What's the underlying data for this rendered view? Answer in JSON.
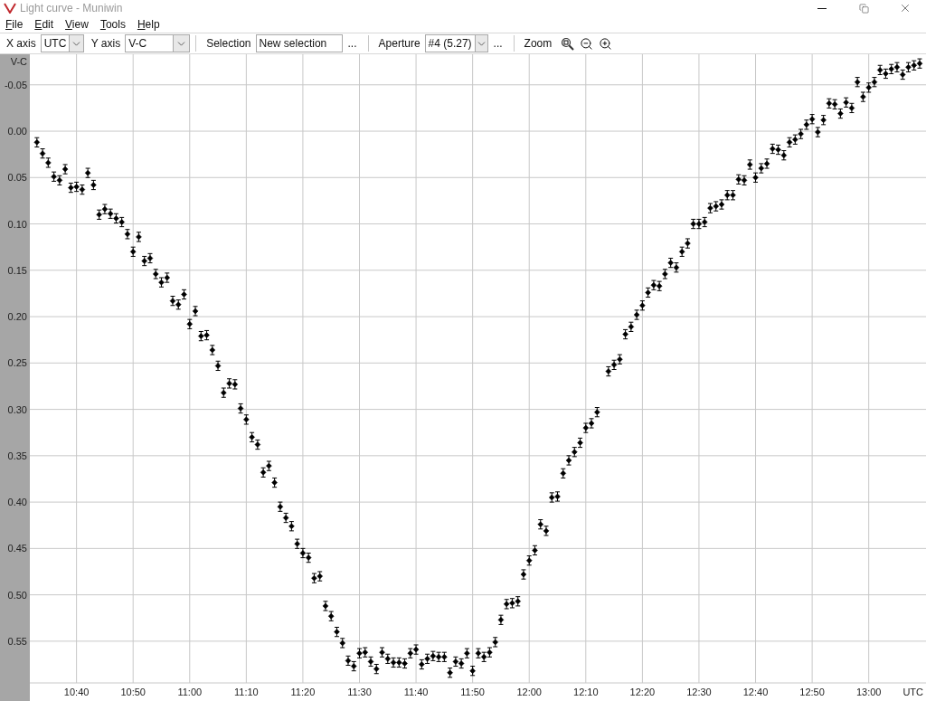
{
  "window": {
    "title": "Light curve - Muniwin"
  },
  "menu": [
    "File",
    "Edit",
    "View",
    "Tools",
    "Help"
  ],
  "toolbar": {
    "x_axis": {
      "label": "X axis",
      "value": "UTC"
    },
    "y_axis": {
      "label": "Y axis",
      "value": "V-C"
    },
    "selection": {
      "label": "Selection",
      "value": "New selection",
      "more": "..."
    },
    "aperture": {
      "label": "Aperture",
      "value": "#4 (5.27)",
      "more": "..."
    },
    "zoom": {
      "label": "Zoom"
    }
  },
  "chart": {
    "chart_data": {
      "type": "scatter",
      "xlabel": "UTC",
      "ylabel": "V-C",
      "grid": true,
      "xlim": [
        631.75,
        789.8
      ],
      "ylim": [
        0.595,
        -0.081
      ],
      "xticks": [
        {
          "value": 640,
          "label": "10:40"
        },
        {
          "value": 650,
          "label": "10:50"
        },
        {
          "value": 660,
          "label": "11:00"
        },
        {
          "value": 670,
          "label": "11:10"
        },
        {
          "value": 680,
          "label": "11:20"
        },
        {
          "value": 690,
          "label": "11:30"
        },
        {
          "value": 700,
          "label": "11:40"
        },
        {
          "value": 710,
          "label": "11:50"
        },
        {
          "value": 720,
          "label": "12:00"
        },
        {
          "value": 730,
          "label": "12:10"
        },
        {
          "value": 740,
          "label": "12:20"
        },
        {
          "value": 750,
          "label": "12:30"
        },
        {
          "value": 760,
          "label": "12:40"
        },
        {
          "value": 770,
          "label": "12:50"
        },
        {
          "value": 780,
          "label": "13:00"
        }
      ],
      "yticks": [
        {
          "value": -0.05,
          "label": "-0.05"
        },
        {
          "value": 0,
          "label": "0.00"
        },
        {
          "value": 0.05,
          "label": "0.05"
        },
        {
          "value": 0.1,
          "label": "0.10"
        },
        {
          "value": 0.15,
          "label": "0.15"
        },
        {
          "value": 0.2,
          "label": "0.20"
        },
        {
          "value": 0.25,
          "label": "0.25"
        },
        {
          "value": 0.3,
          "label": "0.30"
        },
        {
          "value": 0.35,
          "label": "0.35"
        },
        {
          "value": 0.4,
          "label": "0.40"
        },
        {
          "value": 0.45,
          "label": "0.45"
        },
        {
          "value": 0.5,
          "label": "0.50"
        },
        {
          "value": 0.55,
          "label": "0.55"
        }
      ],
      "x": [
        633,
        634,
        635,
        636,
        637,
        638,
        639,
        640,
        641,
        642,
        643,
        644,
        645,
        646,
        647,
        648,
        649,
        650,
        651,
        652,
        653,
        654,
        655,
        656,
        657,
        658,
        659,
        660,
        661,
        662,
        663,
        664,
        665,
        666,
        667,
        668,
        669,
        670,
        671,
        672,
        673,
        674,
        675,
        676,
        677,
        678,
        679,
        680,
        681,
        682,
        683,
        684,
        685,
        686,
        687,
        688,
        689,
        690,
        691,
        692,
        693,
        694,
        695,
        696,
        697,
        698,
        699,
        700,
        701,
        702,
        703,
        704,
        705,
        706,
        707,
        708,
        709,
        710,
        711,
        712,
        713,
        714,
        715,
        716,
        717,
        718,
        719,
        720,
        721,
        722,
        723,
        724,
        725,
        726,
        727,
        728,
        729,
        730,
        731,
        732,
        734,
        735,
        736,
        737,
        738,
        739,
        740,
        741,
        742,
        743,
        744,
        745,
        746,
        747,
        748,
        749,
        750,
        751,
        752,
        753,
        754,
        755,
        756,
        757,
        758,
        759,
        760,
        761,
        762,
        763,
        764,
        765,
        766,
        767,
        768,
        769,
        770,
        771,
        772,
        773,
        774,
        775,
        776,
        777,
        778,
        779,
        780,
        781,
        782,
        783,
        784,
        785,
        786,
        787,
        788,
        789
      ],
      "series": [
        {
          "color": "#000000",
          "errors": [
            0.005,
            0.005,
            0.005,
            0.005,
            0.005,
            0.005,
            0.005,
            0.005,
            0.005,
            0.005,
            0.005,
            0.005,
            0.005,
            0.005,
            0.005,
            0.005,
            0.005,
            0.005,
            0.005,
            0.005,
            0.005,
            0.005,
            0.005,
            0.005,
            0.005,
            0.005,
            0.005,
            0.005,
            0.005,
            0.005,
            0.005,
            0.005,
            0.005,
            0.005,
            0.005,
            0.005,
            0.005,
            0.005,
            0.005,
            0.005,
            0.005,
            0.005,
            0.005,
            0.005,
            0.005,
            0.005,
            0.005,
            0.005,
            0.005,
            0.005,
            0.005,
            0.005,
            0.005,
            0.005,
            0.005,
            0.005,
            0.005,
            0.005,
            0.005,
            0.005,
            0.005,
            0.005,
            0.005,
            0.005,
            0.005,
            0.005,
            0.005,
            0.005,
            0.005,
            0.005,
            0.005,
            0.005,
            0.005,
            0.005,
            0.005,
            0.005,
            0.005,
            0.005,
            0.005,
            0.005,
            0.005,
            0.005,
            0.005,
            0.005,
            0.005,
            0.005,
            0.005,
            0.005,
            0.005,
            0.005,
            0.005,
            0.005,
            0.005,
            0.005,
            0.005,
            0.005,
            0.005,
            0.005,
            0.005,
            0.005,
            0.005,
            0.005,
            0.005,
            0.005,
            0.005,
            0.005,
            0.005,
            0.005,
            0.005,
            0.005,
            0.005,
            0.005,
            0.005,
            0.005,
            0.005,
            0.005,
            0.005,
            0.005,
            0.005,
            0.005,
            0.005,
            0.005,
            0.005,
            0.005,
            0.005,
            0.005,
            0.005,
            0.005,
            0.005,
            0.005,
            0.005,
            0.005,
            0.005,
            0.005,
            0.005,
            0.005,
            0.005,
            0.005,
            0.005,
            0.005,
            0.005,
            0.005,
            0.005,
            0.005,
            0.005,
            0.005,
            0.005,
            0.005,
            0.005,
            0.005,
            0.005,
            0.005,
            0.005,
            0.005,
            0.005,
            0.005
          ],
          "values": [
            0.012,
            0.024,
            0.034,
            0.049,
            0.053,
            0.041,
            0.061,
            0.06,
            0.063,
            0.045,
            0.058,
            0.09,
            0.084,
            0.089,
            0.094,
            0.098,
            0.111,
            0.13,
            0.114,
            0.14,
            0.137,
            0.154,
            0.163,
            0.158,
            0.183,
            0.187,
            0.176,
            0.208,
            0.194,
            0.221,
            0.22,
            0.236,
            0.253,
            0.282,
            0.272,
            0.273,
            0.299,
            0.311,
            0.33,
            0.338,
            0.368,
            0.361,
            0.379,
            0.405,
            0.417,
            0.426,
            0.445,
            0.455,
            0.46,
            0.482,
            0.48,
            0.512,
            0.523,
            0.54,
            0.552,
            0.571,
            0.577,
            0.563,
            0.562,
            0.572,
            0.58,
            0.562,
            0.569,
            0.573,
            0.573,
            0.574,
            0.563,
            0.559,
            0.575,
            0.569,
            0.566,
            0.567,
            0.567,
            0.584,
            0.572,
            0.574,
            0.563,
            0.582,
            0.563,
            0.567,
            0.562,
            0.551,
            0.527,
            0.51,
            0.509,
            0.507,
            0.478,
            0.463,
            0.452,
            0.424,
            0.431,
            0.395,
            0.394,
            0.369,
            0.355,
            0.346,
            0.336,
            0.32,
            0.315,
            0.303,
            0.259,
            0.252,
            0.246,
            0.219,
            0.211,
            0.198,
            0.188,
            0.174,
            0.166,
            0.167,
            0.154,
            0.142,
            0.147,
            0.13,
            0.121,
            0.1,
            0.1,
            0.098,
            0.083,
            0.081,
            0.079,
            0.069,
            0.069,
            0.052,
            0.053,
            0.036,
            0.05,
            0.04,
            0.035,
            0.019,
            0.02,
            0.026,
            0.012,
            0.009,
            0.003,
            -0.007,
            -0.013,
            0.001,
            -0.012,
            -0.03,
            -0.029,
            -0.019,
            -0.031,
            -0.025,
            -0.053,
            -0.037,
            -0.047,
            -0.053,
            -0.066,
            -0.062,
            -0.067,
            -0.069,
            -0.061,
            -0.069,
            -0.071,
            -0.073
          ]
        }
      ]
    }
  }
}
